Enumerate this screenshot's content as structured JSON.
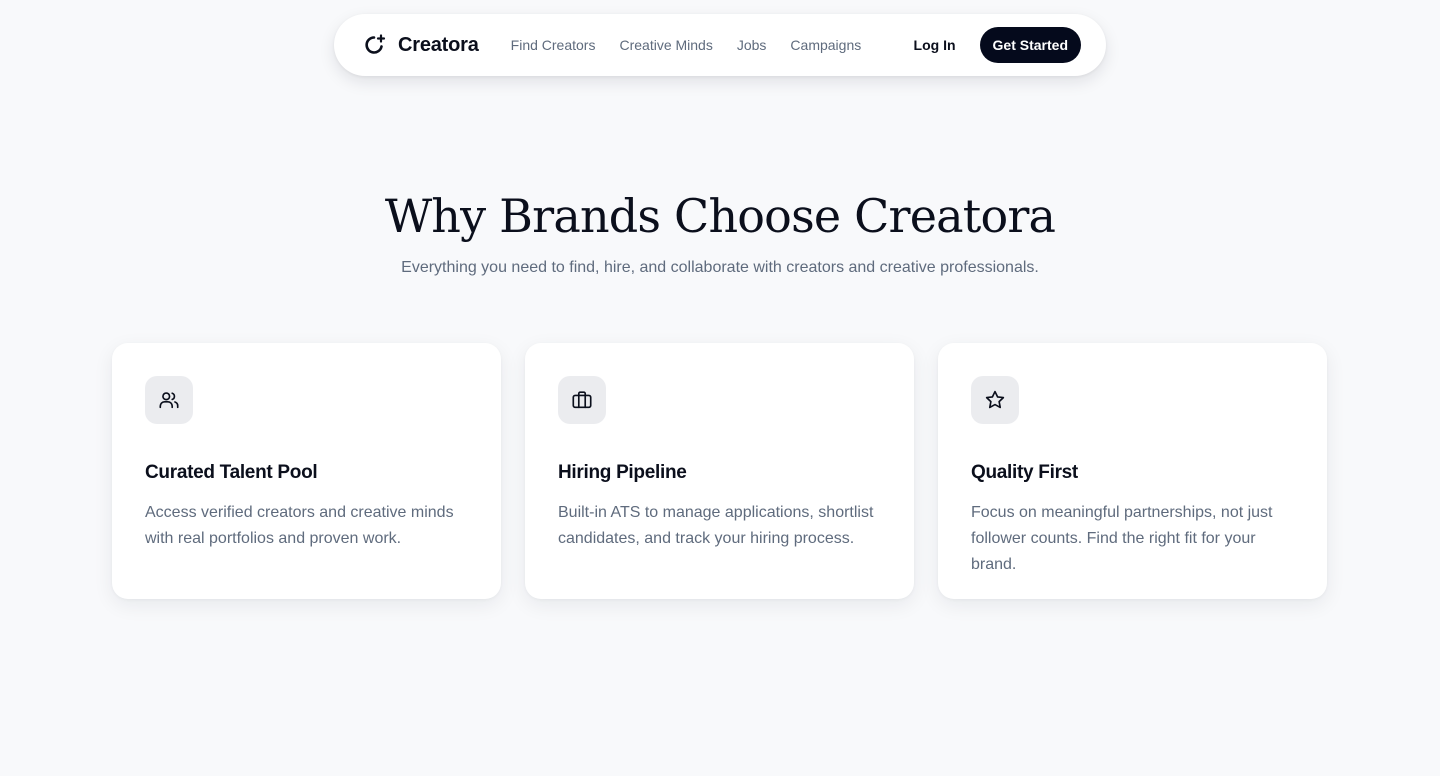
{
  "nav": {
    "brand": "Creatora",
    "links": [
      "Find Creators",
      "Creative Minds",
      "Jobs",
      "Campaigns"
    ],
    "login_label": "Log In",
    "cta_label": "Get Started"
  },
  "section": {
    "title": "Why Brands Choose Creatora",
    "subtitle": "Everything you need to find, hire, and collaborate with creators and creative professionals."
  },
  "features": [
    {
      "icon": "users-icon",
      "title": "Curated Talent Pool",
      "text": "Access verified creators and creative minds with real portfolios and proven work."
    },
    {
      "icon": "briefcase-icon",
      "title": "Hiring Pipeline",
      "text": "Built-in ATS to manage applications, shortlist candidates, and track your hiring process."
    },
    {
      "icon": "star-icon",
      "title": "Quality First",
      "text": "Focus on meaningful partnerships, not just follower counts. Find the right fit for your brand."
    }
  ],
  "colors": {
    "background": "#f8f9fb",
    "primary": "#050a1c",
    "muted_text": "#5f6b7d",
    "icon_tile": "#ebecef"
  }
}
